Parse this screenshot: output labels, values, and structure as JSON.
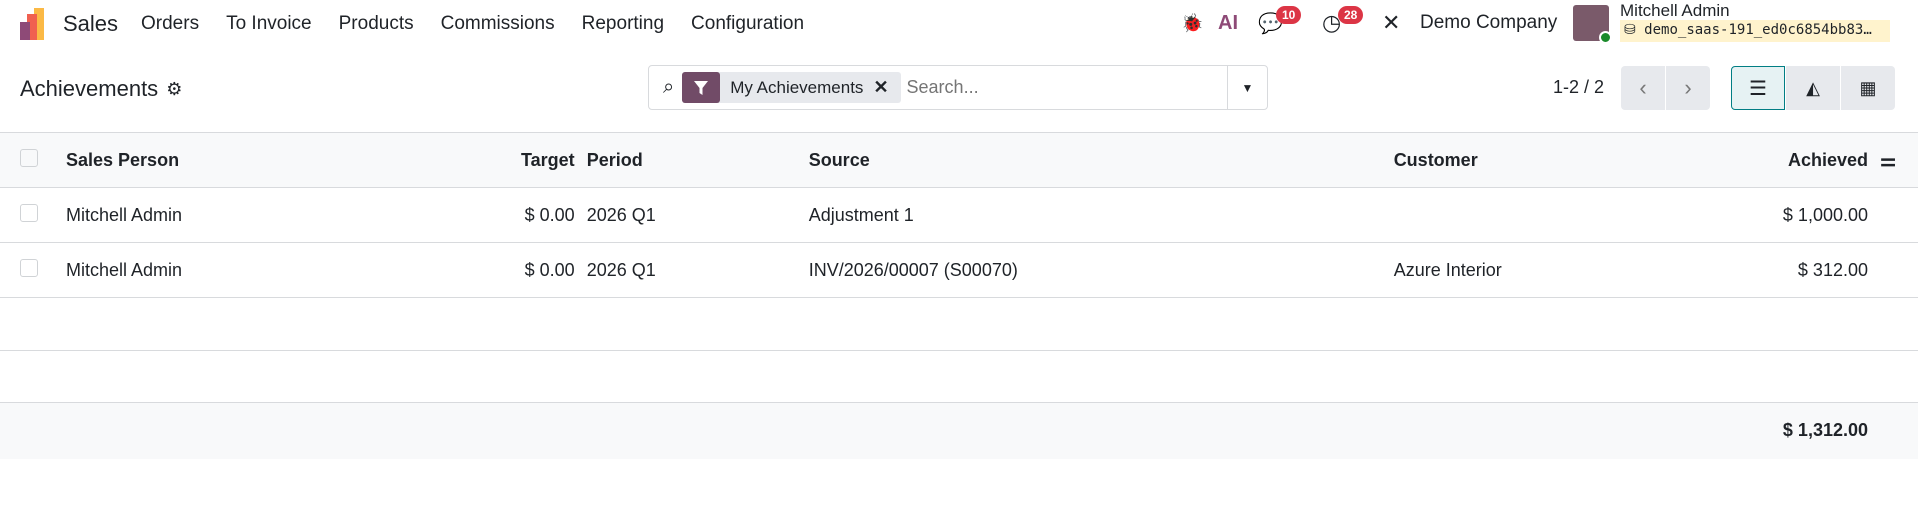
{
  "nav": {
    "app": "Sales",
    "menu": [
      "Orders",
      "To Invoice",
      "Products",
      "Commissions",
      "Reporting",
      "Configuration"
    ],
    "messages_count": "10",
    "activities_count": "28",
    "company": "Demo Company",
    "user": "Mitchell Admin",
    "database": "demo_saas-191_ed0c6854bb83…"
  },
  "control": {
    "title": "Achievements",
    "facet": "My Achievements",
    "search_placeholder": "Search...",
    "pager": "1-2 / 2"
  },
  "table": {
    "headers": [
      "Sales Person",
      "Target",
      "Period",
      "Source",
      "Customer",
      "Achieved"
    ],
    "rows": [
      {
        "person": "Mitchell Admin",
        "target": "$ 0.00",
        "period": "2026 Q1",
        "source": "Adjustment 1",
        "customer": "",
        "achieved": "$ 1,000.00"
      },
      {
        "person": "Mitchell Admin",
        "target": "$ 0.00",
        "period": "2026 Q1",
        "source": "INV/2026/00007 (S00070)",
        "customer": "Azure Interior",
        "achieved": "$ 312.00"
      }
    ],
    "total": "$ 1,312.00"
  }
}
